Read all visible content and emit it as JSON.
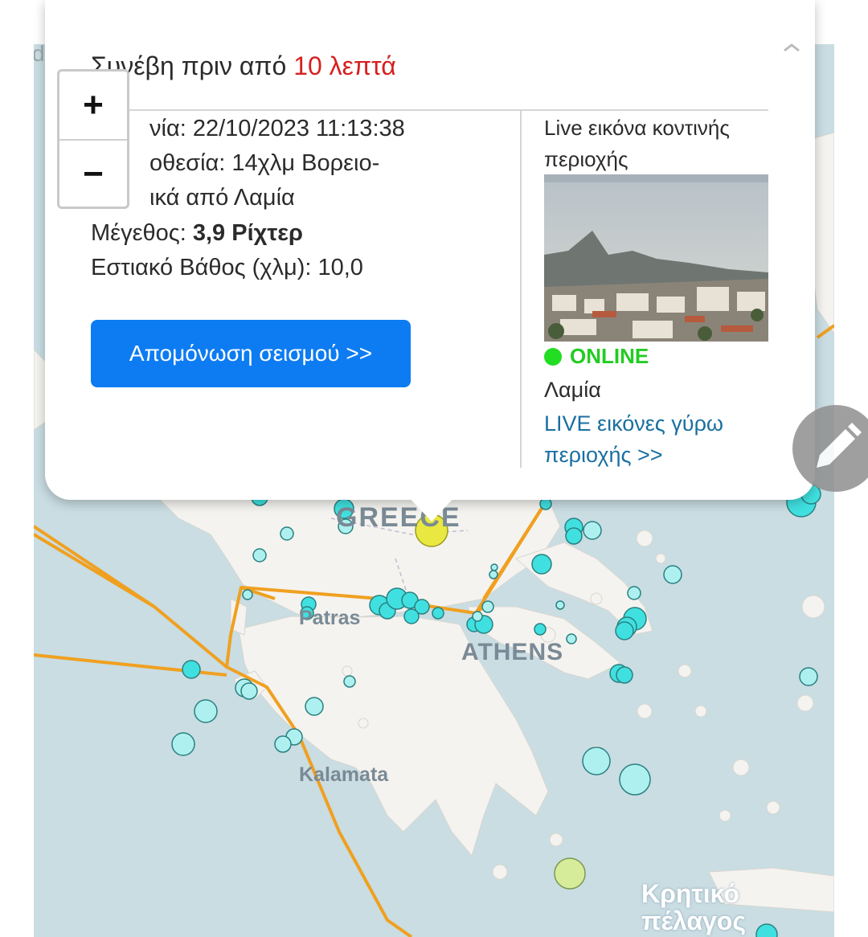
{
  "popup": {
    "occurred_prefix": "Συνέβη πριν από ",
    "occurred_value": "10 λεπτά",
    "date_line": "νία: 22/10/2023 11:13:38",
    "location_line1": "οθεσία: 14χλμ Βορειο-",
    "location_line2": "ικά από Λαμία",
    "magnitude_label": "Μέγεθος: ",
    "magnitude_value": "3,9 Ρίχτερ",
    "depth_line": "Εστιακό Βάθος (χλμ): 10,0",
    "isolate_button": "Απομόνωση σεισμού >>",
    "camera_title_line1": "Live εικόνα κοντινής",
    "camera_title_line2": "περιοχής",
    "status": "ONLINE",
    "camera_city": "Λαμία",
    "live_link_line1": "LIVE εικόνες γύρω",
    "live_link_line2": "περιοχής >>",
    "close_icon": "chevron-up-icon"
  },
  "zoom": {
    "in_label": "+",
    "out_label": "−"
  },
  "map": {
    "places": {
      "greece": "GREECE",
      "patras": "Patras",
      "athens": "ATHENS",
      "kalamata": "Kalamata",
      "cretan_sea_line1": "Κρητικό",
      "cretan_sea_line2": "πέλαγος"
    },
    "edge_label": "d"
  },
  "colors": {
    "accent_red": "#d62020",
    "button_blue": "#0d7cf2",
    "link_blue": "#1a6fa0",
    "online_green": "#22dd22",
    "fault_orange": "#f0a020",
    "quake_cyan": "#40e0e0",
    "quake_yellow": "#e8e840"
  },
  "fab_icon": "pencil-icon"
}
